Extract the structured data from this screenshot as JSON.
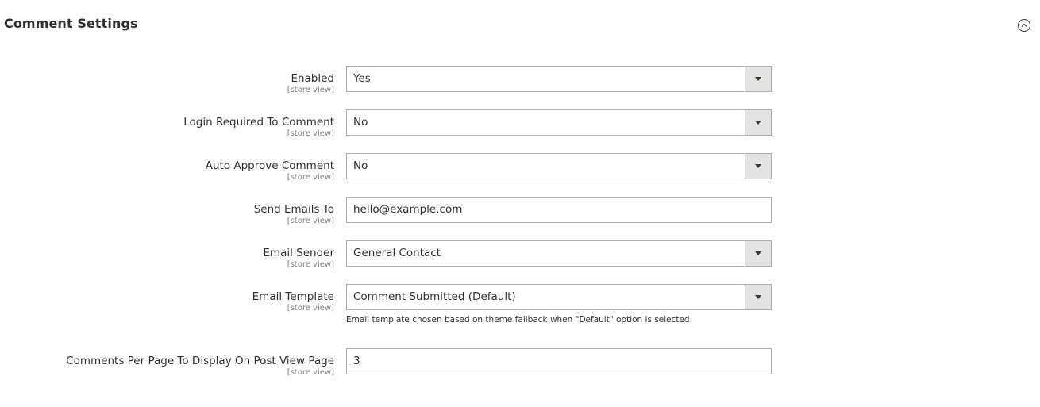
{
  "section": {
    "title": "Comment Settings",
    "toggle_icon": "chevron-up-circle-icon"
  },
  "fields": [
    {
      "label": "Enabled",
      "scope": "[store view]",
      "type": "select",
      "value": "Yes"
    },
    {
      "label": "Login Required To Comment",
      "scope": "[store view]",
      "type": "select",
      "value": "No"
    },
    {
      "label": "Auto Approve Comment",
      "scope": "[store view]",
      "type": "select",
      "value": "No"
    },
    {
      "label": "Send Emails To",
      "scope": "[store view]",
      "type": "text",
      "value": "hello@example.com"
    },
    {
      "label": "Email Sender",
      "scope": "[store view]",
      "type": "select",
      "value": "General Contact"
    },
    {
      "label": "Email Template",
      "scope": "[store view]",
      "type": "select",
      "value": "Comment Submitted (Default)",
      "note": "Email template chosen based on theme fallback when \"Default\" option is selected."
    },
    {
      "label": "Comments Per Page To Display On Post View Page",
      "scope": "[store view]",
      "type": "text",
      "value": "3"
    }
  ],
  "colors": {
    "text": "#303030",
    "scope": "#808080",
    "border": "#adadad",
    "select_button": "#e3e3e3"
  }
}
